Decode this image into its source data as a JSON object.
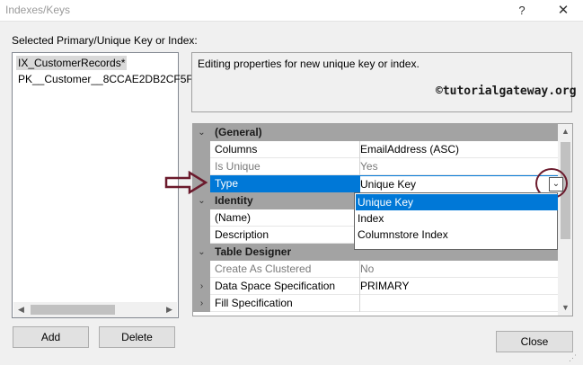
{
  "window": {
    "title": "Indexes/Keys",
    "help": "?",
    "close_glyph": "✕"
  },
  "selected_label": "Selected Primary/Unique Key or Index:",
  "keys": [
    {
      "label": "IX_CustomerRecords*",
      "selected": true
    },
    {
      "label": "PK__Customer__8CCAE2DB2CF5F",
      "selected": false
    }
  ],
  "description": "Editing properties for new unique key or index.",
  "watermark": "©tutorialgateway.org",
  "grid": {
    "general": {
      "label": "(General)",
      "toggle": "⌄"
    },
    "columns": {
      "name": "Columns",
      "value": "EmailAddress (ASC)"
    },
    "is_unique": {
      "name": "Is Unique",
      "value": "Yes"
    },
    "type": {
      "name": "Type",
      "value": "Unique Key"
    },
    "identity": {
      "label": "Identity",
      "toggle": "⌄"
    },
    "name_prop": {
      "name": "(Name)",
      "value": ""
    },
    "description_prop": {
      "name": "Description",
      "value": ""
    },
    "table_designer": {
      "label": "Table Designer",
      "toggle": "⌄"
    },
    "create_clustered": {
      "name": "Create As Clustered",
      "value": "No"
    },
    "data_space": {
      "name": "Data Space Specification",
      "value": "PRIMARY",
      "expander": "›"
    },
    "fill_spec": {
      "name": "Fill Specification",
      "value": "",
      "expander": "›"
    }
  },
  "type_dropdown": {
    "options": [
      "Unique Key",
      "Index",
      "Columnstore Index"
    ],
    "selected": "Unique Key"
  },
  "buttons": {
    "add": "Add",
    "delete": "Delete",
    "close": "Close"
  },
  "colors": {
    "accent": "#0078d7",
    "category_bg": "#a3a3a3",
    "annotation": "#6b1a2c"
  }
}
